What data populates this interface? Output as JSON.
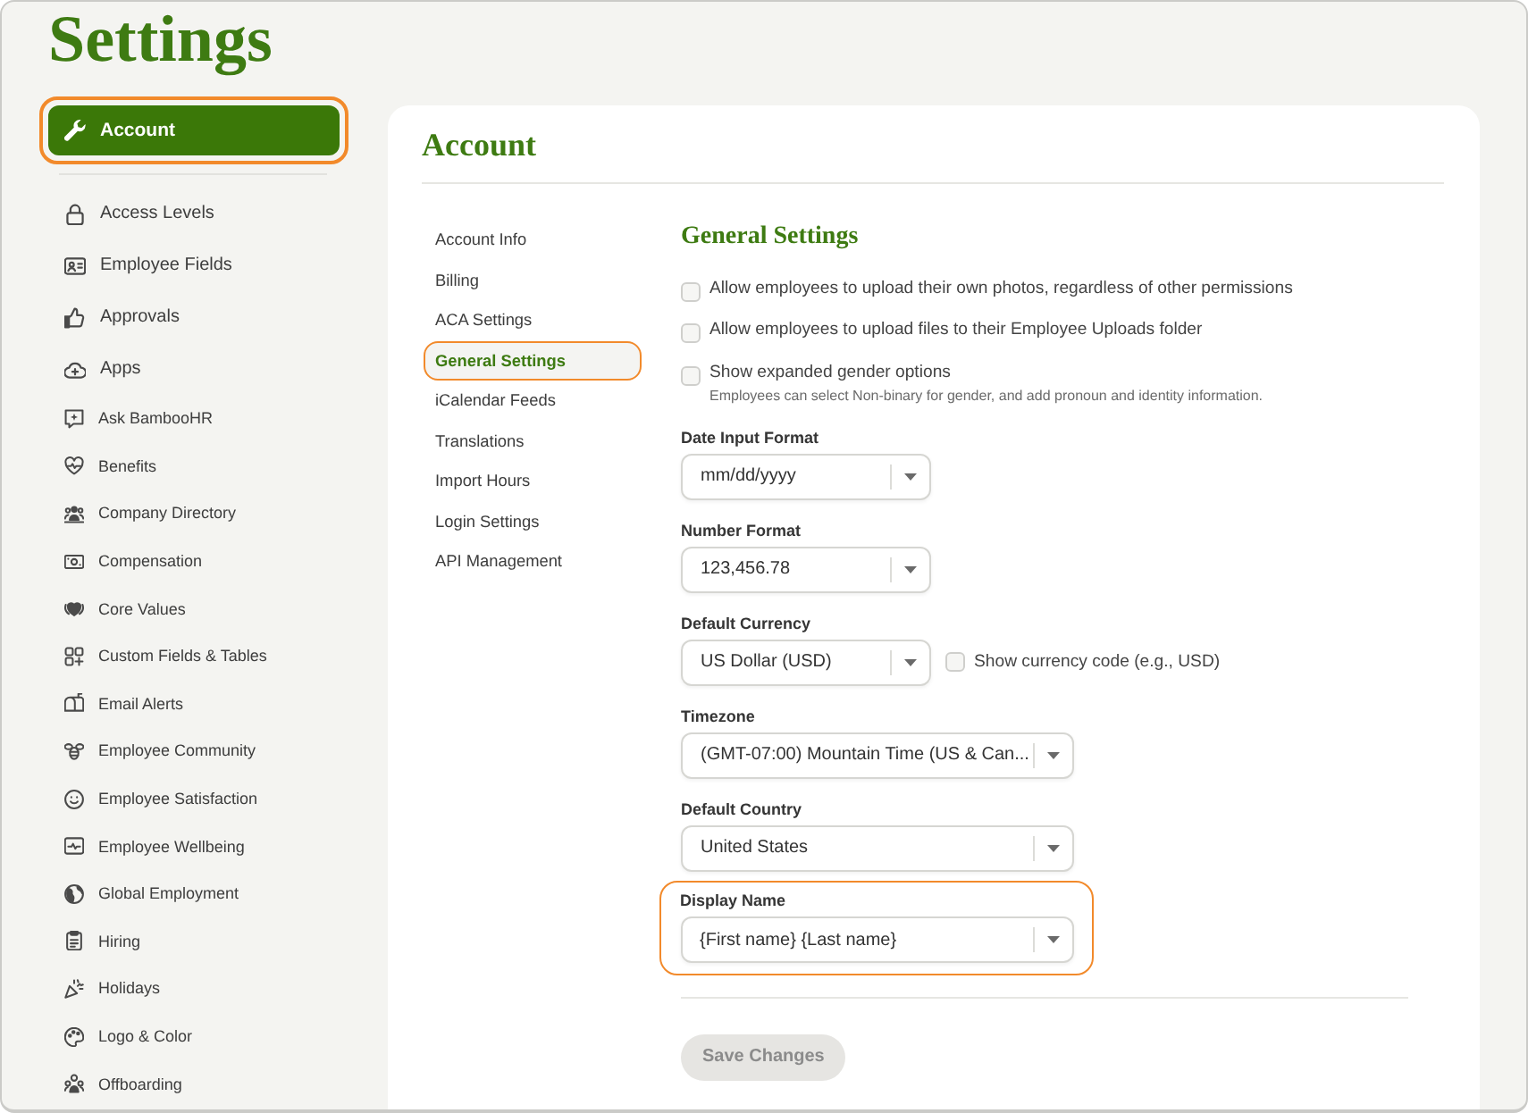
{
  "sidebar": {
    "title": "Settings",
    "items": [
      {
        "label": "Account",
        "kind": "large",
        "selected": true,
        "highlighted": true
      },
      {
        "label": "Access Levels",
        "kind": "large",
        "selected": false,
        "highlighted": false
      },
      {
        "label": "Employee Fields",
        "kind": "large",
        "selected": false,
        "highlighted": false
      },
      {
        "label": "Approvals",
        "kind": "large",
        "selected": false,
        "highlighted": false
      },
      {
        "label": "Apps",
        "kind": "large",
        "selected": false,
        "highlighted": false
      },
      {
        "label": "Ask BambooHR",
        "kind": "small",
        "selected": false,
        "highlighted": false
      },
      {
        "label": "Benefits",
        "kind": "small",
        "selected": false,
        "highlighted": false
      },
      {
        "label": "Company Directory",
        "kind": "small",
        "selected": false,
        "highlighted": false
      },
      {
        "label": "Compensation",
        "kind": "small",
        "selected": false,
        "highlighted": false
      },
      {
        "label": "Core Values",
        "kind": "small",
        "selected": false,
        "highlighted": false
      },
      {
        "label": "Custom Fields & Tables",
        "kind": "small",
        "selected": false,
        "highlighted": false
      },
      {
        "label": "Email Alerts",
        "kind": "small",
        "selected": false,
        "highlighted": false
      },
      {
        "label": "Employee Community",
        "kind": "small",
        "selected": false,
        "highlighted": false
      },
      {
        "label": "Employee Satisfaction",
        "kind": "small",
        "selected": false,
        "highlighted": false
      },
      {
        "label": "Employee Wellbeing",
        "kind": "small",
        "selected": false,
        "highlighted": false
      },
      {
        "label": "Global Employment",
        "kind": "small",
        "selected": false,
        "highlighted": false
      },
      {
        "label": "Hiring",
        "kind": "small",
        "selected": false,
        "highlighted": false
      },
      {
        "label": "Holidays",
        "kind": "small",
        "selected": false,
        "highlighted": false
      },
      {
        "label": "Logo & Color",
        "kind": "small",
        "selected": false,
        "highlighted": false
      },
      {
        "label": "Offboarding",
        "kind": "small",
        "selected": false,
        "highlighted": false
      }
    ]
  },
  "account": {
    "title": "Account",
    "nav": [
      {
        "label": "Account Info",
        "selected": false,
        "highlighted": false
      },
      {
        "label": "Billing",
        "selected": false,
        "highlighted": false
      },
      {
        "label": "ACA Settings",
        "selected": false,
        "highlighted": false
      },
      {
        "label": "General Settings",
        "selected": true,
        "highlighted": true
      },
      {
        "label": "iCalendar Feeds",
        "selected": false,
        "highlighted": false
      },
      {
        "label": "Translations",
        "selected": false,
        "highlighted": false
      },
      {
        "label": "Import Hours",
        "selected": false,
        "highlighted": false
      },
      {
        "label": "Login Settings",
        "selected": false,
        "highlighted": false
      },
      {
        "label": "API Management",
        "selected": false,
        "highlighted": false
      }
    ],
    "general_settings": {
      "title": "General Settings",
      "checkboxes": [
        {
          "label": "Allow employees to upload their own photos, regardless of other permissions",
          "checked": false
        },
        {
          "label": "Allow employees to upload files to their Employee Uploads folder",
          "checked": false
        },
        {
          "label": "Show expanded gender options",
          "checked": false,
          "help": "Employees can select Non-binary for gender, and add pronoun and identity information."
        }
      ],
      "fields": [
        {
          "label": "Date Input Format",
          "value": "mm/dd/yyyy",
          "highlighted": false
        },
        {
          "label": "Number Format",
          "value": "123,456.78",
          "highlighted": false
        },
        {
          "label": "Default Currency",
          "value": "US Dollar (USD)",
          "highlighted": false,
          "checkbox": {
            "label": "Show currency code (e.g., USD)",
            "checked": false
          }
        },
        {
          "label": "Timezone",
          "value": "(GMT-07:00) Mountain Time (US & Can...",
          "highlighted": false
        },
        {
          "label": "Default Country",
          "value": "United States",
          "highlighted": false
        },
        {
          "label": "Display Name",
          "value": "{First name} {Last name}",
          "highlighted": true
        }
      ],
      "save_button": {
        "label": "Save Changes",
        "disabled": true
      }
    }
  }
}
